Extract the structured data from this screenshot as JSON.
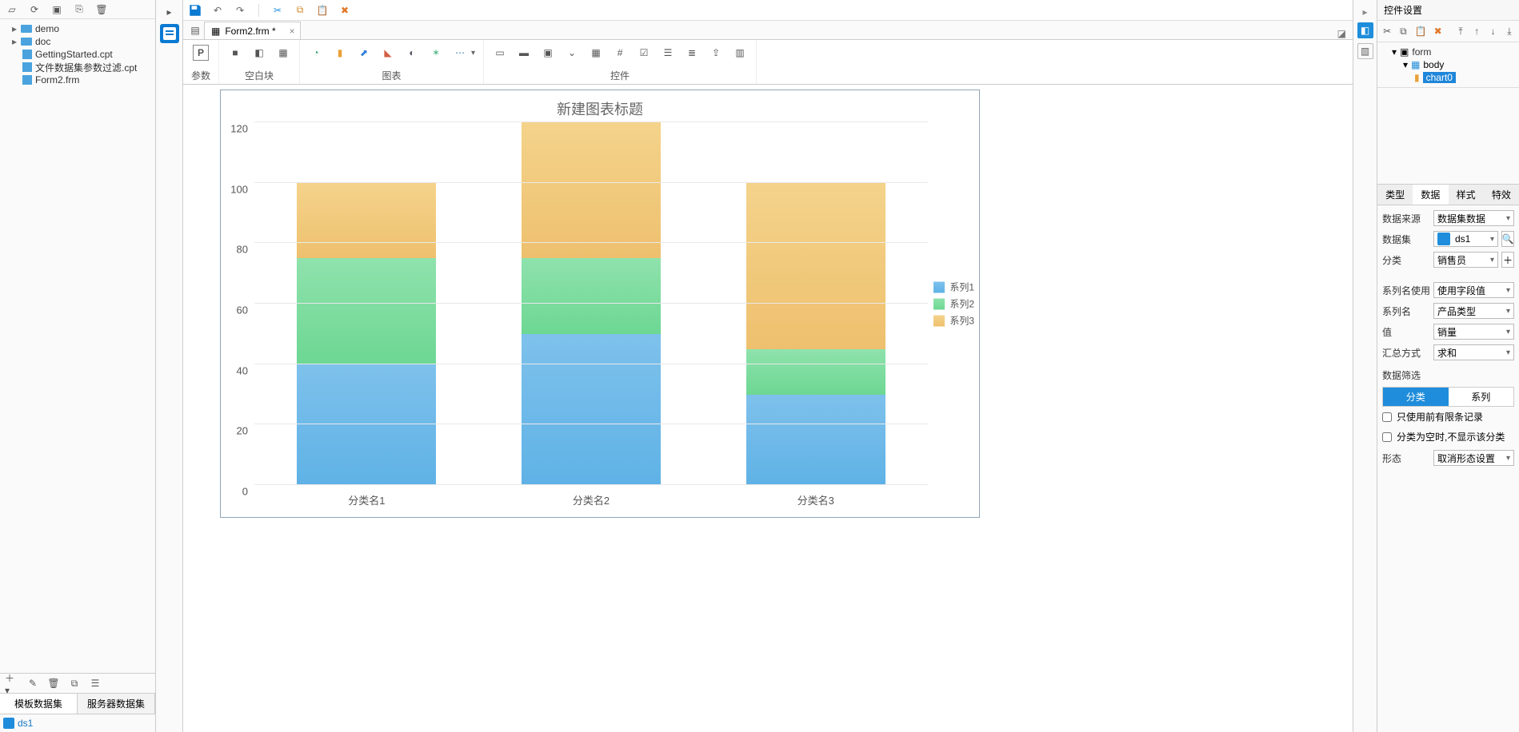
{
  "left": {
    "tree": {
      "demo": "demo",
      "doc": "doc",
      "file1": "GettingStarted.cpt",
      "file2": "文件数据集参数过滤.cpt",
      "file3": "Form2.frm"
    },
    "dataset_tabs": {
      "tpl": "模板数据集",
      "srv": "服务器数据集"
    },
    "ds1": "ds1"
  },
  "tabs": {
    "doc1": "Form2.frm *"
  },
  "ribbon": {
    "param": "参数",
    "blank": "空白块",
    "chart": "图表",
    "widget": "控件"
  },
  "right": {
    "title": "控件设置",
    "tree": {
      "form": "form",
      "body": "body",
      "chart0": "chart0"
    },
    "tabs": {
      "type": "类型",
      "data": "数据",
      "style": "样式",
      "fx": "特效"
    },
    "fields": {
      "data_source_label": "数据来源",
      "data_source_value": "数据集数据",
      "dataset_label": "数据集",
      "dataset_value": "ds1",
      "category_label": "分类",
      "category_value": "销售员",
      "series_name_use_label": "系列名使用",
      "series_name_use_value": "使用字段值",
      "series_name_label": "系列名",
      "series_name_value": "产品类型",
      "value_label": "值",
      "value_value": "销量",
      "agg_label": "汇总方式",
      "agg_value": "求和"
    },
    "filter_title": "数据筛选",
    "filter_tabs": {
      "cat": "分类",
      "ser": "系列"
    },
    "chk_topn": "只使用前有限条记录",
    "chk_hide_empty": "分类为空时,不显示该分类",
    "shape_label": "形态",
    "shape_value": "取消形态设置"
  },
  "chart_data": {
    "type": "bar",
    "stacked": true,
    "title": "新建图表标题",
    "categories": [
      "分类名1",
      "分类名2",
      "分类名3"
    ],
    "series": [
      {
        "name": "系列1",
        "color": "#5fb2e6",
        "values": [
          40,
          50,
          30
        ]
      },
      {
        "name": "系列2",
        "color": "#6dd793",
        "values": [
          35,
          25,
          15
        ]
      },
      {
        "name": "系列3",
        "color": "#eec06e",
        "values": [
          25,
          45,
          55
        ]
      }
    ],
    "ylim": [
      0,
      120
    ],
    "y_ticks": [
      0,
      20,
      40,
      60,
      80,
      100,
      120
    ],
    "xlabel": "",
    "ylabel": ""
  }
}
